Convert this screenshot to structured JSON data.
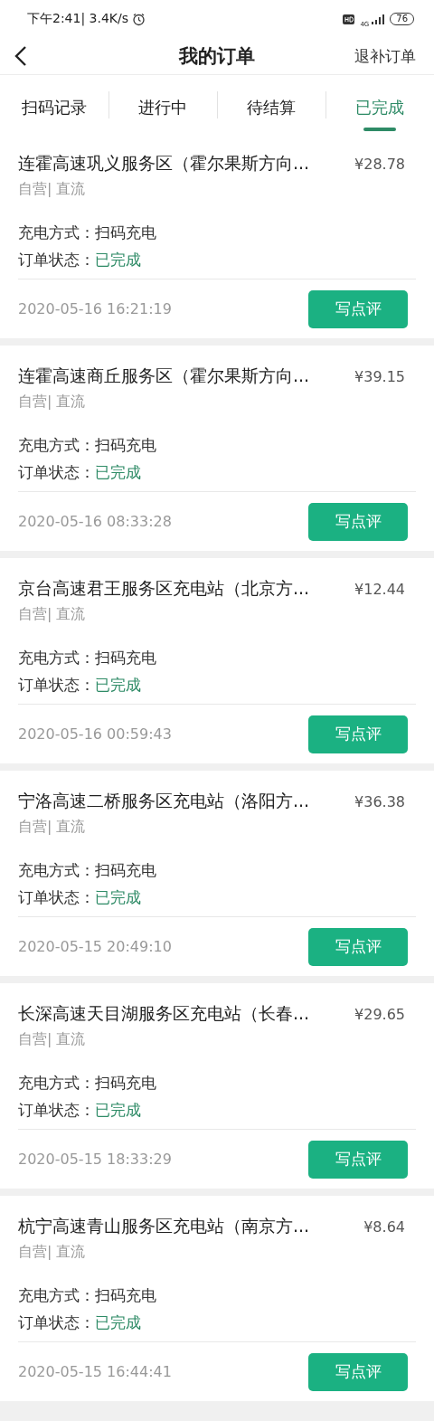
{
  "status_bar": {
    "time_speed": "下午2:41| 3.4K/s",
    "network": "4G",
    "battery": "76"
  },
  "header": {
    "title": "我的订单",
    "action": "退补订单"
  },
  "tabs": [
    {
      "label": "扫码记录",
      "selected": false
    },
    {
      "label": "进行中",
      "selected": false
    },
    {
      "label": "待结算",
      "selected": false
    },
    {
      "label": "已完成",
      "selected": true
    }
  ],
  "orders": [
    {
      "station": "连霍高速巩义服务区（霍尔果斯方向...",
      "price": "¥28.78",
      "tags": "自营| 直流",
      "method_label": "充电方式：",
      "method": "扫码充电",
      "status_label": "订单状态：",
      "status": "已完成",
      "time": "2020-05-16 16:21:19",
      "button": "写点评"
    },
    {
      "station": "连霍高速商丘服务区（霍尔果斯方向...",
      "price": "¥39.15",
      "tags": "自营| 直流",
      "method_label": "充电方式：",
      "method": "扫码充电",
      "status_label": "订单状态：",
      "status": "已完成",
      "time": "2020-05-16 08:33:28",
      "button": "写点评"
    },
    {
      "station": "京台高速君王服务区充电站（北京方...",
      "price": "¥12.44",
      "tags": "自营| 直流",
      "method_label": "充电方式：",
      "method": "扫码充电",
      "status_label": "订单状态：",
      "status": "已完成",
      "time": "2020-05-16 00:59:43",
      "button": "写点评"
    },
    {
      "station": "宁洛高速二桥服务区充电站（洛阳方...",
      "price": "¥36.38",
      "tags": "自营| 直流",
      "method_label": "充电方式：",
      "method": "扫码充电",
      "status_label": "订单状态：",
      "status": "已完成",
      "time": "2020-05-15 20:49:10",
      "button": "写点评"
    },
    {
      "station": "长深高速天目湖服务区充电站（长春...",
      "price": "¥29.65",
      "tags": "自营| 直流",
      "method_label": "充电方式：",
      "method": "扫码充电",
      "status_label": "订单状态：",
      "status": "已完成",
      "time": "2020-05-15 18:33:29",
      "button": "写点评"
    },
    {
      "station": "杭宁高速青山服务区充电站（南京方...",
      "price": "¥8.64",
      "tags": "自营| 直流",
      "method_label": "充电方式：",
      "method": "扫码充电",
      "status_label": "订单状态：",
      "status": "已完成",
      "time": "2020-05-15 16:44:41",
      "button": "写点评"
    }
  ]
}
